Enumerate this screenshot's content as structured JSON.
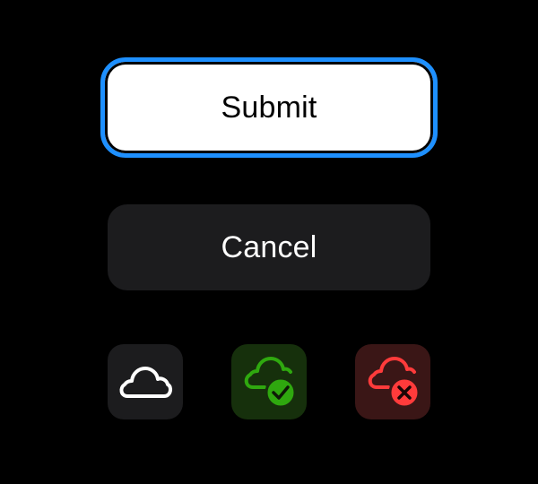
{
  "buttons": {
    "submit_label": "Submit",
    "cancel_label": "Cancel"
  },
  "icon_buttons": [
    {
      "icon": "cloud-icon",
      "state": "default",
      "color": "#ffffff",
      "background": "#1c1c1e"
    },
    {
      "icon": "cloud-check-icon",
      "state": "success",
      "color": "#2fa80f",
      "background": "#16300c"
    },
    {
      "icon": "cloud-error-icon",
      "state": "error",
      "color": "#ff3b3b",
      "background": "#3a1616"
    }
  ],
  "colors": {
    "background": "#000000",
    "focus_ring": "#1e90ff",
    "submit_fill": "#ffffff",
    "cancel_fill": "#1c1c1e",
    "success": "#2fa80f",
    "error": "#ff3b3b"
  }
}
